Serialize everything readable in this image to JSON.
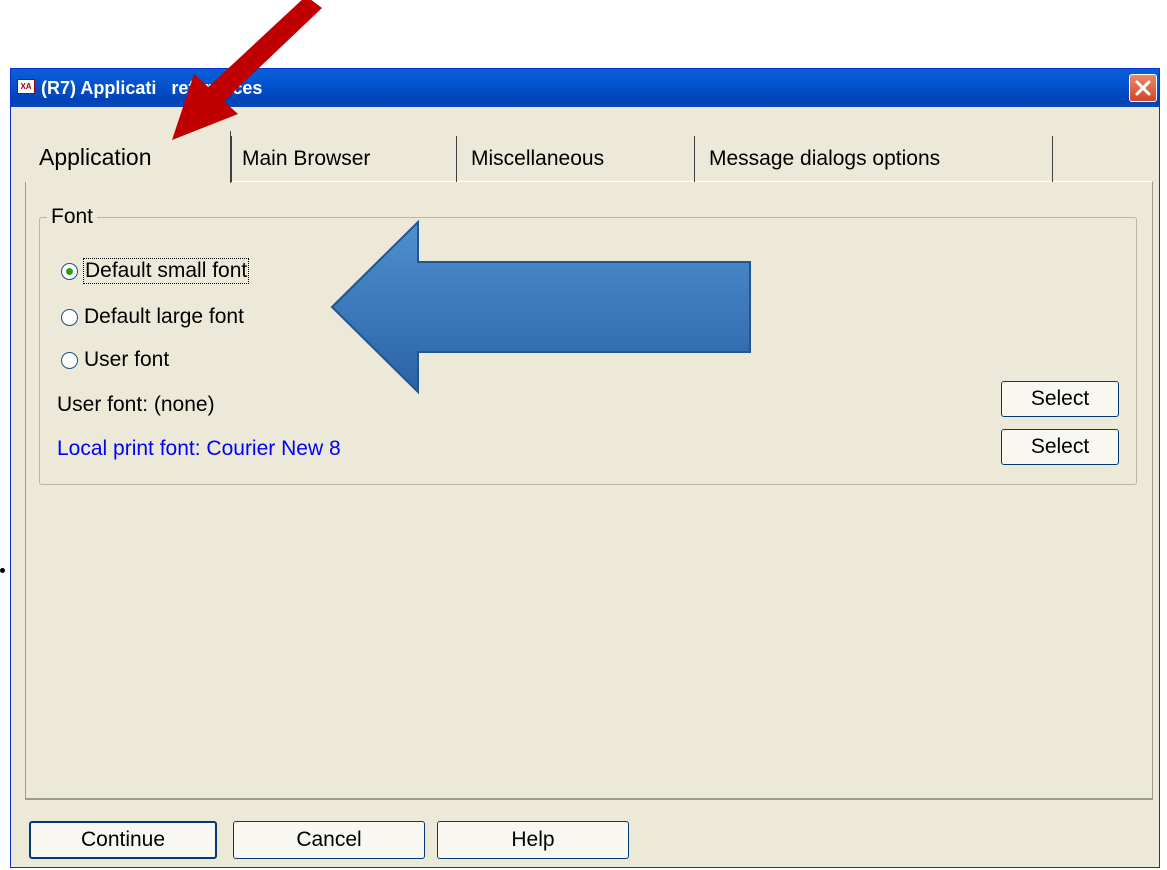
{
  "window": {
    "title": "(R7) Applicati   references",
    "icon": "app-icon",
    "icon_text": "XA",
    "close_icon": "close-icon"
  },
  "tabs": [
    {
      "label": "Application",
      "active": true
    },
    {
      "label": "Main Browser",
      "active": false
    },
    {
      "label": "Miscellaneous",
      "active": false
    },
    {
      "label": "Message dialogs options",
      "active": false
    }
  ],
  "font_group": {
    "legend": "Font",
    "options": [
      {
        "label": "Default small font",
        "selected": true
      },
      {
        "label": "Default large font",
        "selected": false
      },
      {
        "label": "User font",
        "selected": false
      }
    ],
    "user_font_text": "User font: (none)",
    "local_print_font_text": "Local print font: Courier New 8",
    "select_label_1": "Select",
    "select_label_2": "Select"
  },
  "buttons": {
    "continue": "Continue",
    "cancel": "Cancel",
    "help": "Help"
  },
  "colors": {
    "title_bar": "#0352cc",
    "link_text": "#0000ff",
    "red_arrow": "#c00000",
    "blue_arrow": "#2f6fb3"
  }
}
